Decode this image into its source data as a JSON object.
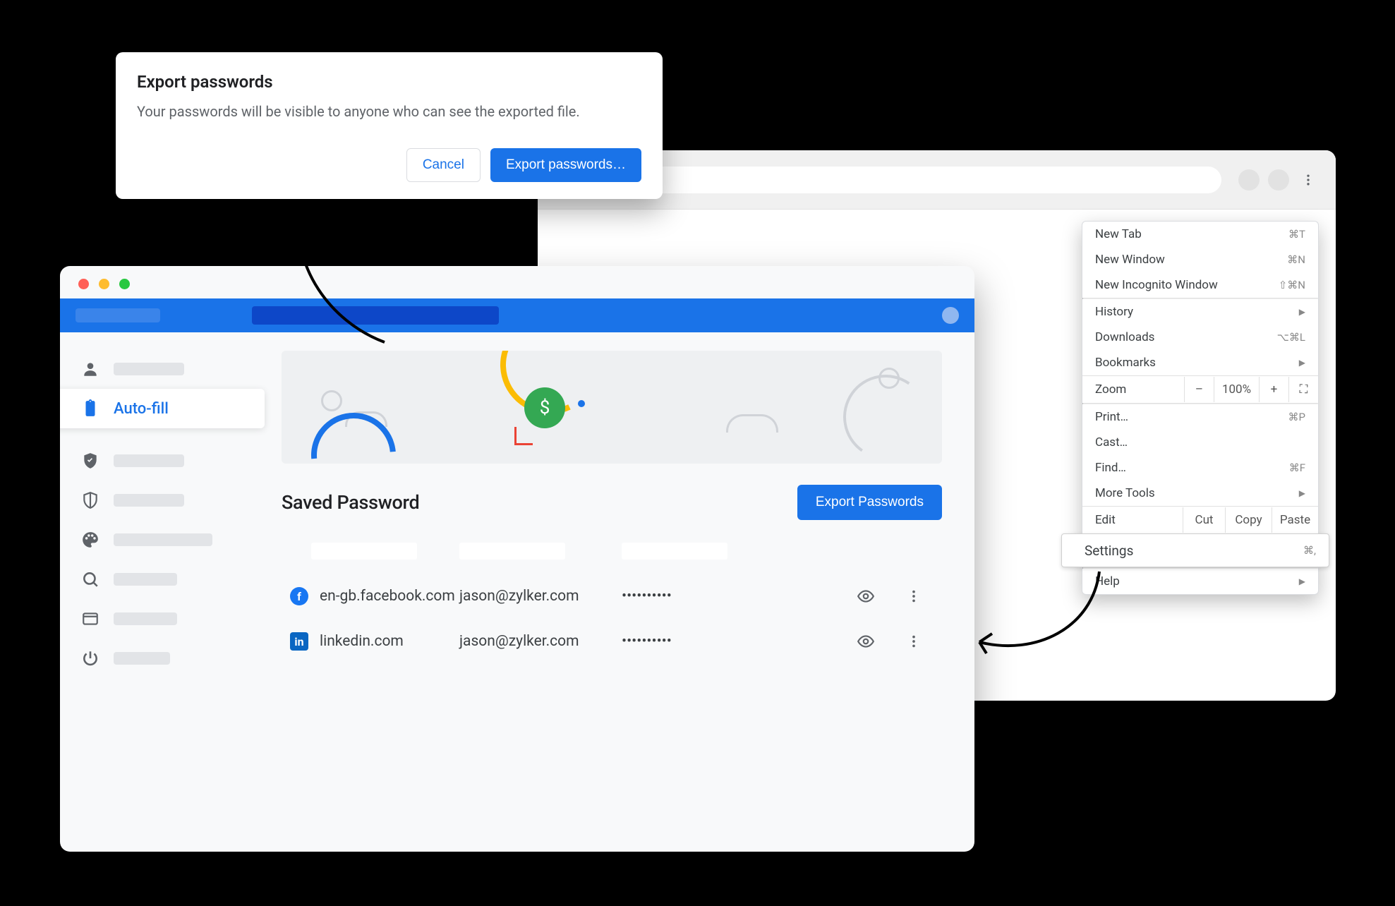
{
  "dialog": {
    "title": "Export passwords",
    "body": "Your passwords will be visible to anyone who can see the exported file.",
    "cancel_label": "Cancel",
    "confirm_label": "Export passwords…"
  },
  "browser_menu": {
    "items": [
      {
        "label": "New Tab",
        "shortcut": "⌘T"
      },
      {
        "label": "New Window",
        "shortcut": "⌘N"
      },
      {
        "label": "New Incognito Window",
        "shortcut": "⇧⌘N"
      }
    ],
    "section2": [
      {
        "label": "History",
        "arrow": true
      },
      {
        "label": "Downloads",
        "shortcut": "⌥⌘L"
      },
      {
        "label": "Bookmarks",
        "arrow": true
      }
    ],
    "zoom": {
      "label": "Zoom",
      "minus": "–",
      "percent": "100%",
      "plus": "+",
      "full": "⛶"
    },
    "section3": [
      {
        "label": "Print…",
        "shortcut": "⌘P"
      },
      {
        "label": "Cast…"
      },
      {
        "label": "Find…",
        "shortcut": "⌘F"
      },
      {
        "label": "More Tools",
        "arrow": true
      }
    ],
    "edit_row": {
      "label": "Edit",
      "cut": "Cut",
      "copy": "Copy",
      "paste": "Paste"
    },
    "settings": {
      "label": "Settings",
      "shortcut": "⌘,"
    },
    "help": {
      "label": "Help",
      "arrow": true
    }
  },
  "settings": {
    "sidebar": {
      "autofill_label": "Auto-fill"
    },
    "panel": {
      "heading": "Saved Password",
      "export_button": "Export Passwords",
      "rows": [
        {
          "icon": "facebook",
          "site": "en-gb.facebook.com",
          "user": "jason@zylker.com",
          "pw": "••••••••••"
        },
        {
          "icon": "linkedin",
          "site": "linkedin.com",
          "user": "jason@zylker.com",
          "pw": "••••••••••"
        }
      ]
    }
  }
}
